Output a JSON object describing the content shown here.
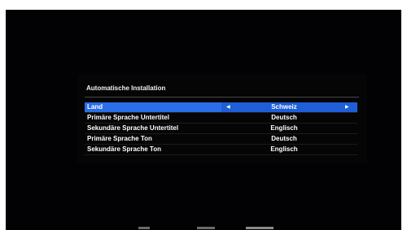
{
  "dialog": {
    "title": "Automatische Installation"
  },
  "settings": [
    {
      "label": "Land",
      "value": "Schweiz",
      "selected": true
    },
    {
      "label": "Primäre Sprache Untertitel",
      "value": "Deutsch",
      "selected": false
    },
    {
      "label": "Sekundäre Sprache Untertitel",
      "value": "Englisch",
      "selected": false
    },
    {
      "label": "Primäre Sprache Ton",
      "value": "Deutsch",
      "selected": false
    },
    {
      "label": "Sekundäre Sprache Ton",
      "value": "Englisch",
      "selected": false
    }
  ],
  "icons": {
    "left": "chevron-left-icon",
    "right": "chevron-right-icon"
  },
  "colors": {
    "highlight": "#1e5fd8",
    "highlight_label": "#2a6fe8",
    "background": "#020204",
    "text": "#ffffff"
  }
}
